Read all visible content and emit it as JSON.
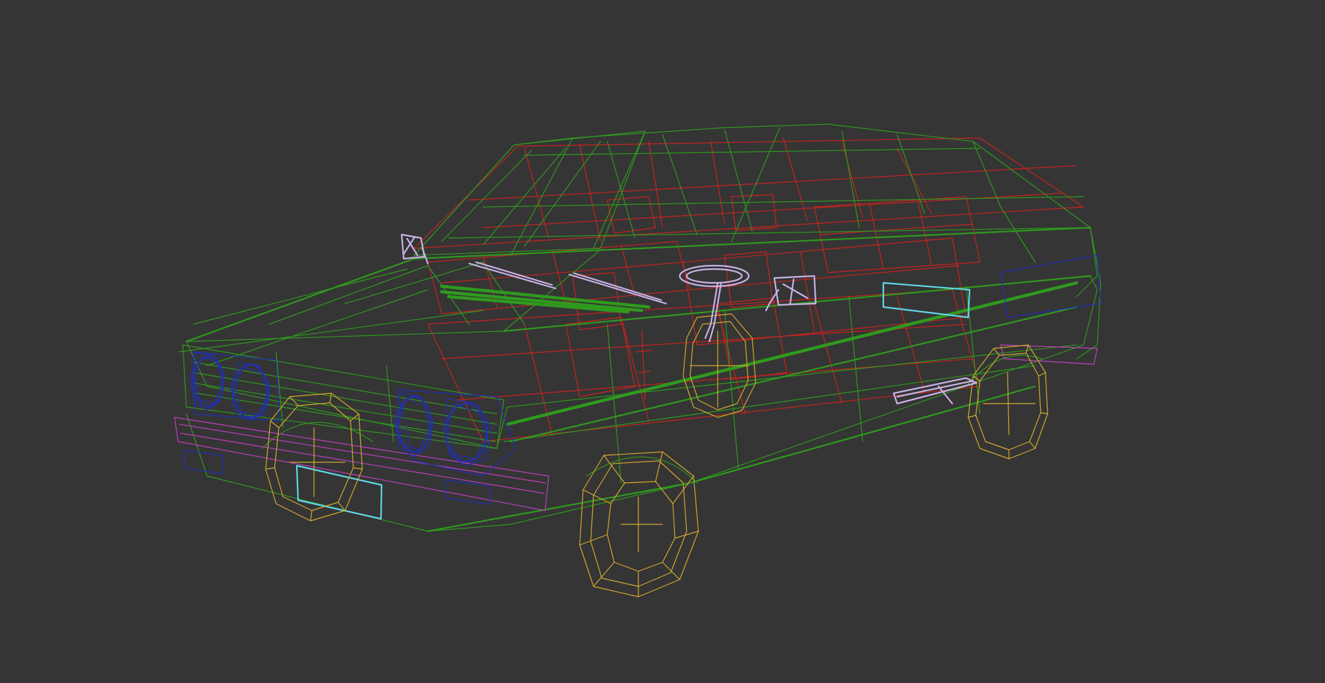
{
  "viewport": {
    "background": "#353535",
    "render_mode": "wireframe"
  },
  "model": {
    "colors": {
      "body": "#2f9a1e",
      "interior": "#c8231f",
      "wheels": "#d4aa2e",
      "lights": "#2030b8",
      "bumpers": "#c040c0",
      "plates": "#5fd8e8",
      "trim": "#c9b3e8"
    },
    "parts": [
      {
        "name": "body-shell",
        "icon": "car-body-wireframe"
      },
      {
        "name": "interior",
        "icon": "seat-wireframe"
      },
      {
        "name": "wheels",
        "icon": "wheel-wireframe"
      },
      {
        "name": "headlights",
        "icon": "headlight-wireframe"
      },
      {
        "name": "bumpers",
        "icon": "bumper-wireframe"
      },
      {
        "name": "license-plates",
        "icon": "plate-wireframe"
      },
      {
        "name": "mirrors-wipers-steering",
        "icon": "trim-wireframe"
      }
    ]
  }
}
